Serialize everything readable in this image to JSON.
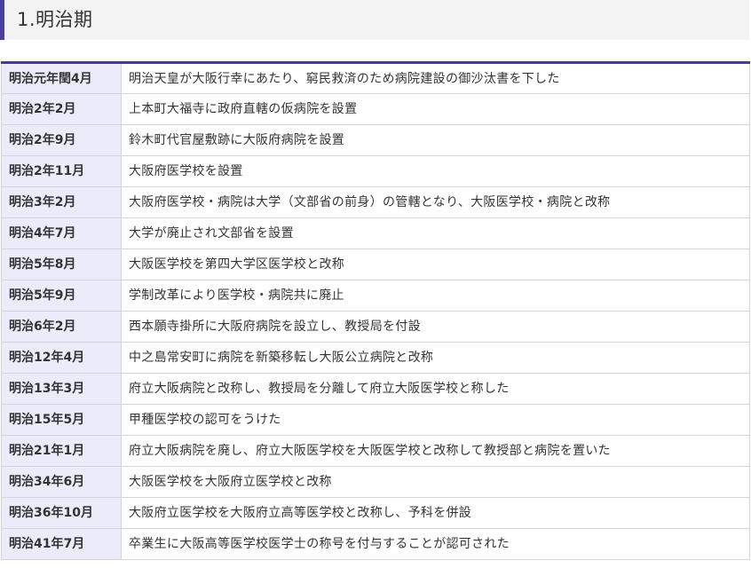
{
  "heading": {
    "title": "1.明治期",
    "accent_color": "#4a3f9e"
  },
  "table": {
    "border_color": "#433b92",
    "date_cell_color": "#ebebf9",
    "rows": [
      {
        "date": "明治元年閏4月",
        "event": "明治天皇が大阪行幸にあたり、窮民救済のため病院建設の御沙汰書を下した"
      },
      {
        "date": "明治2年2月",
        "event": "上本町大福寺に政府直轄の仮病院を設置"
      },
      {
        "date": "明治2年9月",
        "event": "鈴木町代官屋敷跡に大阪府病院を設置"
      },
      {
        "date": "明治2年11月",
        "event": "大阪府医学校を設置"
      },
      {
        "date": "明治3年2月",
        "event": "大阪府医学校・病院は大学（文部省の前身）の管轄となり、大阪医学校・病院と改称"
      },
      {
        "date": "明治4年7月",
        "event": "大学が廃止され文部省を設置"
      },
      {
        "date": "明治5年8月",
        "event": "大阪医学校を第四大学区医学校と改称"
      },
      {
        "date": "明治5年9月",
        "event": "学制改革により医学校・病院共に廃止"
      },
      {
        "date": "明治6年2月",
        "event": "西本願寺掛所に大阪府病院を設立し、教授局を付設"
      },
      {
        "date": "明治12年4月",
        "event": "中之島常安町に病院を新築移転し大阪公立病院と改称"
      },
      {
        "date": "明治13年3月",
        "event": "府立大阪病院と改称し、教授局を分離して府立大阪医学校と称した"
      },
      {
        "date": "明治15年5月",
        "event": "甲種医学校の認可をうけた"
      },
      {
        "date": "明治21年1月",
        "event": "府立大阪病院を廃し、府立大阪医学校を大阪医学校と改称して教授部と病院を置いた"
      },
      {
        "date": "明治34年6月",
        "event": "大阪医学校を大阪府立医学校と改称"
      },
      {
        "date": "明治36年10月",
        "event": "大阪府立医学校を大阪府立高等医学校と改称し、予科を併設"
      },
      {
        "date": "明治41年7月",
        "event": "卒業生に大阪高等医学校医学士の称号を付与することが認可された"
      }
    ]
  }
}
